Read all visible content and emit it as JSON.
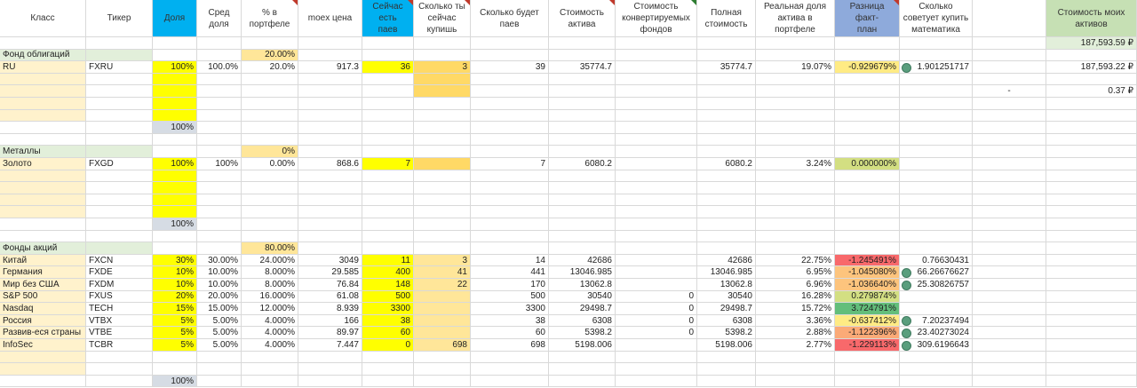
{
  "colors": {
    "yellow": "#ffff00",
    "lightOrange": "#ffe699",
    "orange": "#ffd966",
    "sectionGreen": "#e2efda",
    "cream": "#fff2cc",
    "cyan": "#00b0f0",
    "blueGray": "#8eaadb",
    "totalGray": "#d6dce4",
    "headerGreen": "#c6e0b4",
    "totalCellGreen": "#e2efda",
    "red": "#f8696b",
    "lightRed": "#fbaa77",
    "midOrange": "#fdc47d",
    "paleYellow": "#ffeb84",
    "yellowGreen": "#d3df82",
    "green": "#63be7b"
  },
  "headers": {
    "klass": "Класс",
    "ticker": "Тикер",
    "dolya": "Доля",
    "sred": [
      "Сред",
      "доля"
    ],
    "pct": [
      "% в",
      "портфеле"
    ],
    "moex": "moex цена",
    "now": [
      "Сейчас есть",
      "паев"
    ],
    "buy": [
      "Сколько ты",
      "сейчас",
      "купишь"
    ],
    "will": [
      "Сколько будет",
      "паев"
    ],
    "cost": [
      "Стоимость",
      "актива"
    ],
    "conv": [
      "Стоимость",
      "конвертируемых",
      "фондов"
    ],
    "full": [
      "Полная",
      "стоимость"
    ],
    "real": [
      "Реальная доля",
      "актива в портфеле"
    ],
    "diff": [
      "Разница факт-",
      "план"
    ],
    "math": [
      "Сколько",
      "советует купить",
      "математика"
    ],
    "total": [
      "Стоимость моих",
      "активов"
    ]
  },
  "right_panel": {
    "total_value": "187,593.59 ₽",
    "value2": "187,593.22 ₽",
    "dash": "-",
    "value3": "0.37 ₽"
  },
  "sections": {
    "bonds": {
      "name": "Фонд облигаций",
      "pct": "20.00%",
      "total": "100%"
    },
    "metals": {
      "name": "Металлы",
      "pct": "0%",
      "total": "100%"
    },
    "stocks": {
      "name": "Фонды акций",
      "pct": "80.00%",
      "total": "100%"
    }
  },
  "rows": {
    "ru": {
      "name": "RU",
      "ticker": "FXRU",
      "dolya": "100%",
      "sred": "100.0%",
      "pct": "20.0%",
      "moex": "917.3",
      "now": "36",
      "buy": "3",
      "will": "39",
      "cost": "35774.7",
      "conv": "",
      "full": "35774.7",
      "real": "19.07%",
      "diff": "-0.929679%",
      "math": "1.901251717"
    },
    "gold": {
      "name": "Золото",
      "ticker": "FXGD",
      "dolya": "100%",
      "sred": "100%",
      "pct": "0.00%",
      "moex": "868.6",
      "now": "7",
      "buy": "",
      "will": "7",
      "cost": "6080.2",
      "conv": "",
      "full": "6080.2",
      "real": "3.24%",
      "diff": "0.000000%",
      "math": ""
    },
    "china": {
      "name": "Китай",
      "ticker": "FXCN",
      "dolya": "30%",
      "sred": "30.00%",
      "pct": "24.000%",
      "moex": "3049",
      "now": "11",
      "buy": "3",
      "will": "14",
      "cost": "42686",
      "conv": "",
      "full": "42686",
      "real": "22.75%",
      "diff": "-1.245491%",
      "math": "0.76630431"
    },
    "germany": {
      "name": "Германия",
      "ticker": "FXDE",
      "dolya": "10%",
      "sred": "10.00%",
      "pct": "8.000%",
      "moex": "29.585",
      "now": "400",
      "buy": "41",
      "will": "441",
      "cost": "13046.985",
      "conv": "",
      "full": "13046.985",
      "real": "6.95%",
      "diff": "-1.045080%",
      "math": "66.26676627"
    },
    "world": {
      "name": "Мир без США",
      "ticker": "FXDM",
      "dolya": "10%",
      "sred": "10.00%",
      "pct": "8.000%",
      "moex": "76.84",
      "now": "148",
      "buy": "22",
      "will": "170",
      "cost": "13062.8",
      "conv": "",
      "full": "13062.8",
      "real": "6.96%",
      "diff": "-1.036640%",
      "math": "25.30826757"
    },
    "sp500": {
      "name": "S&P 500",
      "ticker": "FXUS",
      "dolya": "20%",
      "sred": "20.00%",
      "pct": "16.000%",
      "moex": "61.08",
      "now": "500",
      "buy": "",
      "will": "500",
      "cost": "30540",
      "conv": "0",
      "full": "30540",
      "real": "16.28%",
      "diff": "0.279874%",
      "math": ""
    },
    "nasdaq": {
      "name": "Nasdaq",
      "ticker": "TECH",
      "dolya": "15%",
      "sred": "15.00%",
      "pct": "12.000%",
      "moex": "8.939",
      "now": "3300",
      "buy": "",
      "will": "3300",
      "cost": "29498.7",
      "conv": "0",
      "full": "29498.7",
      "real": "15.72%",
      "diff": "3.724791%",
      "math": ""
    },
    "russia": {
      "name": "Россия",
      "ticker": "VTBX",
      "dolya": "5%",
      "sred": "5.00%",
      "pct": "4.000%",
      "moex": "166",
      "now": "38",
      "buy": "",
      "will": "38",
      "cost": "6308",
      "conv": "0",
      "full": "6308",
      "real": "3.36%",
      "diff": "-0.637412%",
      "math": "7.20237494"
    },
    "emerging": {
      "name": "Развив-еся страны",
      "ticker": "VTBE",
      "dolya": "5%",
      "sred": "5.00%",
      "pct": "4.000%",
      "moex": "89.97",
      "now": "60",
      "buy": "",
      "will": "60",
      "cost": "5398.2",
      "conv": "0",
      "full": "5398.2",
      "real": "2.88%",
      "diff": "-1.122396%",
      "math": "23.40273024"
    },
    "infosec": {
      "name": "InfoSec",
      "ticker": "TCBR",
      "dolya": "5%",
      "sred": "5.00%",
      "pct": "4.000%",
      "moex": "7.447",
      "now": "0",
      "buy": "698",
      "will": "698",
      "cost": "5198.006",
      "conv": "",
      "full": "5198.006",
      "real": "2.77%",
      "diff": "-1.229113%",
      "math": "309.6196643"
    }
  }
}
